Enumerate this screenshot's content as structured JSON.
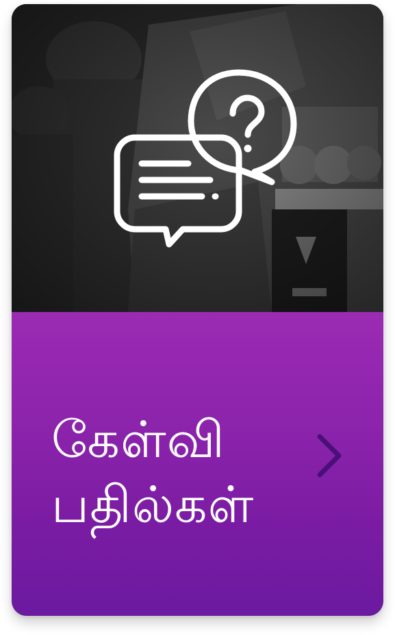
{
  "card": {
    "title_line1": "கேள்வி",
    "title_line2": "பதில்கள்",
    "hero_icon": "chat-question-icon",
    "action_icon": "chevron-right-icon",
    "colors": {
      "panel_top": "#9b2bb3",
      "panel_bottom": "#6b1aa0",
      "chevron": "#4a1078",
      "text": "#ffffff"
    }
  }
}
